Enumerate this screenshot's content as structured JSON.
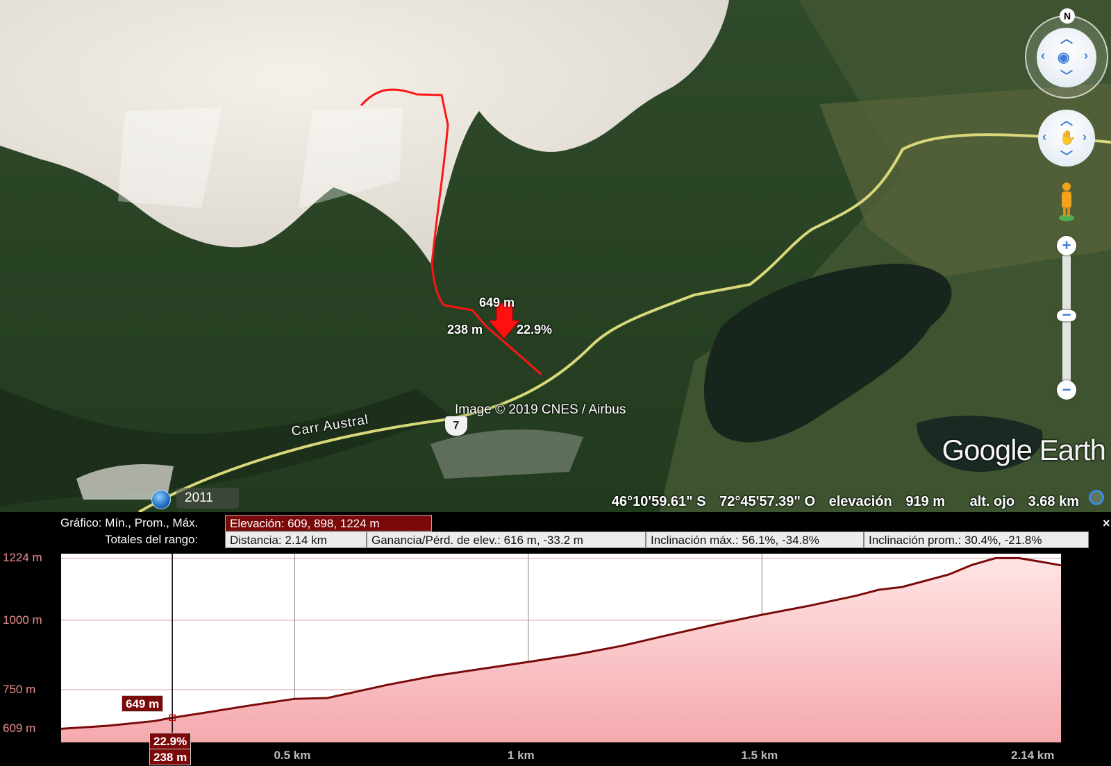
{
  "map": {
    "credit": "Image © 2019 CNES / Airbus",
    "road_label": "Carr Austral",
    "road_shield": "7",
    "logo_google": "Google",
    "logo_earth": "Earth",
    "hover": {
      "elevation": "649 m",
      "distance": "238 m",
      "slope": "22.9%"
    },
    "north_label": "N",
    "historical_year": "2011"
  },
  "status": {
    "latitude": "46°10'59.61\" S",
    "longitude": "72°45'57.39\" O",
    "elevation_label": "elevación",
    "elevation_value": "919 m",
    "eye_alt_label": "alt. ojo",
    "eye_alt_value": "3.68 km"
  },
  "profile": {
    "row1_label": "Gráfico: Mín., Prom., Máx.",
    "row1_value": "Elevación: 609, 898, 1224 m",
    "row2_label": "Totales del rango:",
    "distance": "Distancia: 2.14 km",
    "gain_loss": "Ganancia/Pérd. de elev.: 616 m, -33.2 m",
    "max_slope": "Inclinación máx.: 56.1%, -34.8%",
    "avg_slope": "Inclinación prom.: 30.4%, -21.8%",
    "close": "×",
    "cursor_elevation": "649 m",
    "cursor_slope": "22.9%",
    "cursor_distance": "238 m"
  },
  "chart_data": {
    "type": "area",
    "ylabel": "",
    "xlabel": "",
    "y_ticks": [
      "1224 m",
      "1000 m",
      "750 m",
      "609 m"
    ],
    "y_tick_values": [
      1224,
      1000,
      750,
      609
    ],
    "x_ticks": [
      "0.5 km",
      "1 km",
      "1.5 km",
      "2.14 km"
    ],
    "x_tick_values": [
      0.5,
      1,
      1.5,
      2.14
    ],
    "xlim": [
      0,
      2.14
    ],
    "ylim": [
      560,
      1240
    ],
    "x": [
      0,
      0.1,
      0.2,
      0.238,
      0.3,
      0.4,
      0.5,
      0.57,
      0.7,
      0.8,
      0.9,
      1.0,
      1.1,
      1.2,
      1.3,
      1.4,
      1.5,
      1.6,
      1.7,
      1.75,
      1.8,
      1.9,
      1.95,
      2.0,
      2.05,
      2.1,
      2.14
    ],
    "y": [
      609,
      620,
      637,
      649,
      665,
      692,
      717,
      720,
      768,
      800,
      825,
      850,
      876,
      908,
      947,
      985,
      1020,
      1052,
      1088,
      1110,
      1120,
      1165,
      1200,
      1224,
      1224,
      1210,
      1198
    ],
    "cursor_x": 0.238,
    "colors": {
      "line": "#7a0a0a",
      "fill_top": "#ffe2e2",
      "fill_bottom": "#f4a8ad",
      "grid": "#d9a0a0"
    }
  }
}
